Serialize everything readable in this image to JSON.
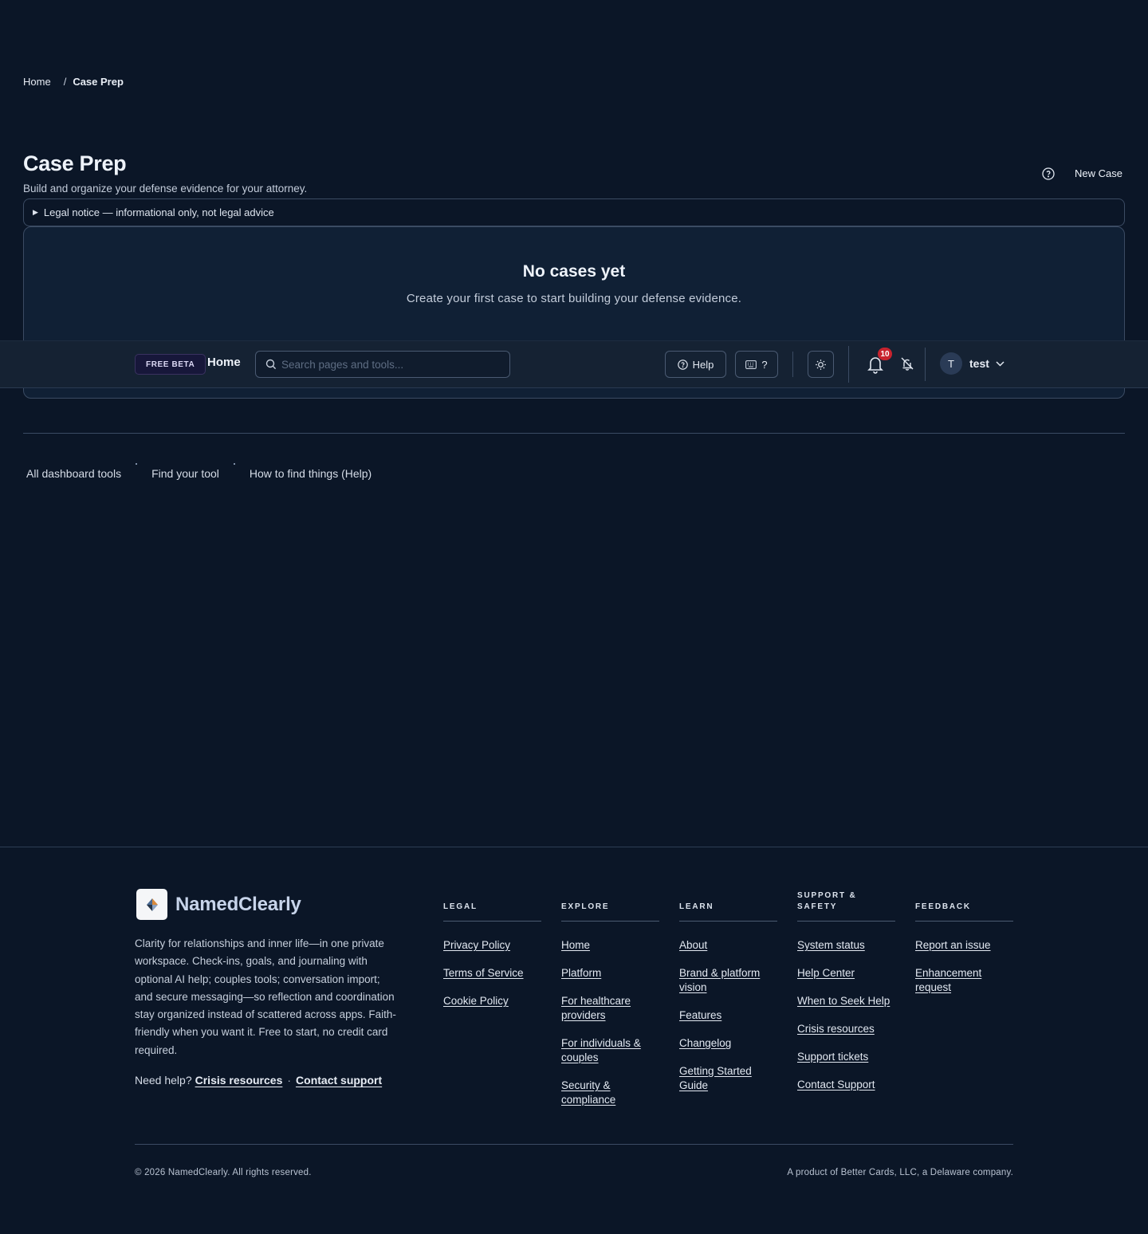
{
  "breadcrumb": {
    "home": "Home",
    "separator": "/",
    "current": "Case Prep"
  },
  "header": {
    "title": "Case Prep",
    "subtitle": "Build and organize your defense evidence for your attorney.",
    "new_case_label": "New Case",
    "help_icon": "question-circle-icon"
  },
  "legal_notice": {
    "label": "Legal notice — informational only, not legal advice"
  },
  "empty_state": {
    "title": "No cases yet",
    "subtitle": "Create your first case to start building your defense evidence."
  },
  "topnav": {
    "beta_badge": "FREE BETA",
    "home_label": "Home",
    "search_placeholder": "Search pages and tools...",
    "help_label": "Help",
    "shortcuts_label": "?",
    "notification_count": "10",
    "user_initial": "T",
    "user_name": "test"
  },
  "quick_links": [
    "All dashboard tools",
    "Find your tool",
    "How to find things (Help)"
  ],
  "footer": {
    "brand_name": "NamedClearly",
    "description": "Clarity for relationships and inner life—in one private workspace. Check-ins, goals, and journaling with optional AI help; couples tools; conversation import; and secure messaging—so reflection and coordination stay organized instead of scattered across apps. Faith-friendly when you want it. Free to start, no credit card required.",
    "need_help": "Need help?",
    "crisis_link": "Crisis resources",
    "mid_dot": "·",
    "contact_link": "Contact support",
    "columns": [
      {
        "heading": "LEGAL",
        "links": [
          "Privacy Policy",
          "Terms of Service",
          "Cookie Policy"
        ]
      },
      {
        "heading": "EXPLORE",
        "links": [
          "Home",
          "Platform",
          "For healthcare providers",
          "For individuals & couples",
          "Security & compliance"
        ]
      },
      {
        "heading": "LEARN",
        "links": [
          "About",
          "Brand & platform vision",
          "Features",
          "Changelog",
          "Getting Started Guide"
        ]
      },
      {
        "heading": "SUPPORT & SAFETY",
        "links": [
          "System status",
          "Help Center",
          "When to Seek Help",
          "Crisis resources",
          "Support tickets",
          "Contact Support"
        ]
      },
      {
        "heading": "FEEDBACK",
        "links": [
          "Report an issue",
          "Enhancement request"
        ]
      }
    ],
    "copyright": "© 2026 NamedClearly. All rights reserved.",
    "product_note": "A product of Better Cards, LLC, a Delaware company."
  },
  "colors": {
    "background": "#0b1627",
    "card": "#102035",
    "nav": "#152233",
    "badge_red": "#c8232e",
    "border": "#3b4b63"
  }
}
